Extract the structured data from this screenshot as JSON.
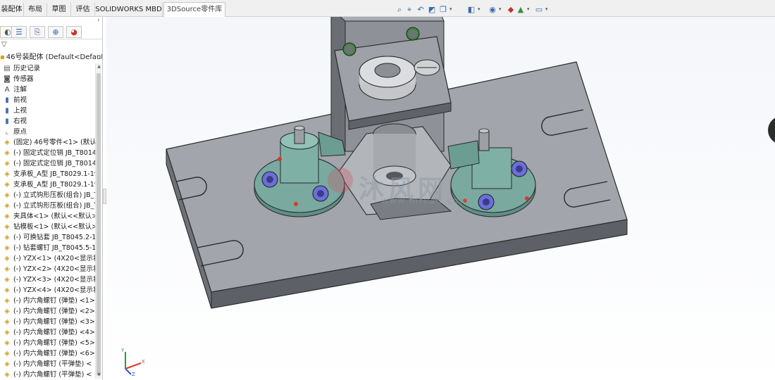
{
  "tabs": [
    "装配体",
    "布局",
    "草图",
    "评估",
    "SOLIDWORKS MBD",
    "3DSource零件库"
  ],
  "active_tab": "3DSource零件库",
  "hud_icons": [
    "zoom-to-fit-icon",
    "zoom-area-icon",
    "previous-view-icon",
    "section-view-icon",
    "view-orientation-icon",
    "display-style-icon",
    "hide-show-icon",
    "appearance-icon",
    "scene-icon",
    "view-settings-icon"
  ],
  "panel": {
    "tab_icons": [
      "feature-manager-icon",
      "property-manager-icon",
      "configuration-manager-icon",
      "dimxpert-icon",
      "display-manager-icon"
    ],
    "filter_symbol": "▽",
    "root_label": "46号装配体  (Default<Default",
    "tree": [
      {
        "icon": "history-icon",
        "label": "历史记录"
      },
      {
        "icon": "sensor-icon",
        "label": "传感器"
      },
      {
        "icon": "annotation-icon",
        "label": "注解"
      },
      {
        "icon": "plane-icon",
        "label": "前视"
      },
      {
        "icon": "plane-icon",
        "label": "上视"
      },
      {
        "icon": "plane-icon",
        "label": "右视"
      },
      {
        "icon": "origin-icon",
        "label": "原点"
      },
      {
        "icon": "part-icon",
        "label": "(固定) 46号零件<1> (默认<"
      },
      {
        "icon": "part-icon",
        "label": "(-) 固定式定位销 JB_T8014"
      },
      {
        "icon": "part-icon",
        "label": "(-) 固定式定位销 JB_T8014"
      },
      {
        "icon": "part-icon",
        "label": "支承板_A型 JB_T8029.1-19"
      },
      {
        "icon": "part-icon",
        "label": "支承板_A型 JB_T8029.1-19"
      },
      {
        "icon": "part-icon",
        "label": "(-) 立式钩形压板(组合) JB_T"
      },
      {
        "icon": "part-icon",
        "label": "(-) 立式钩形压板(组合) JB_T"
      },
      {
        "icon": "part-icon",
        "label": "夹具体<1> (默认<<默认>_"
      },
      {
        "icon": "part-icon",
        "label": "钻模板<1> (默认<<默认>_"
      },
      {
        "icon": "part-icon",
        "label": "(-) 可换钻套 JB_T8045.2-19"
      },
      {
        "icon": "part-icon",
        "label": "(-) 钻套螺钉 JB_T8045.5-19"
      },
      {
        "icon": "part-icon",
        "label": "(-) YZX<1> (4X20<显示状"
      },
      {
        "icon": "part-icon",
        "label": "(-) YZX<2> (4X20<显示状"
      },
      {
        "icon": "part-icon",
        "label": "(-) YZX<3> (4X20<显示状"
      },
      {
        "icon": "part-icon",
        "label": "(-) YZX<4> (4X20<显示状"
      },
      {
        "icon": "part-icon",
        "label": "(-) 内六角螺钉 (弹垫) <1>"
      },
      {
        "icon": "part-icon",
        "label": "(-) 内六角螺钉 (弹垫) <2>"
      },
      {
        "icon": "part-icon",
        "label": "(-) 内六角螺钉 (弹垫) <3>"
      },
      {
        "icon": "part-icon",
        "label": "(-) 内六角螺钉 (弹垫) <4>"
      },
      {
        "icon": "part-icon",
        "label": "(-) 内六角螺钉 (弹垫) <5>"
      },
      {
        "icon": "part-icon",
        "label": "(-) 内六角螺钉 (弹垫) <6>"
      },
      {
        "icon": "part-icon",
        "label": "(-) 内六角螺钉 (平弹垫) <"
      },
      {
        "icon": "part-icon",
        "label": "(-) 内六角螺钉 (平弹垫) <"
      }
    ]
  },
  "watermark": {
    "text": "沐风网",
    "url": "www.mfcad.com"
  },
  "triad": {
    "x": "X",
    "y": "Y",
    "z": "Z"
  },
  "colors": {
    "part_gray": "#8a8d93",
    "clamp_green": "#6f9e95",
    "pin_red": "#d83a2a",
    "bolt_blue": "#6c6fd8"
  }
}
